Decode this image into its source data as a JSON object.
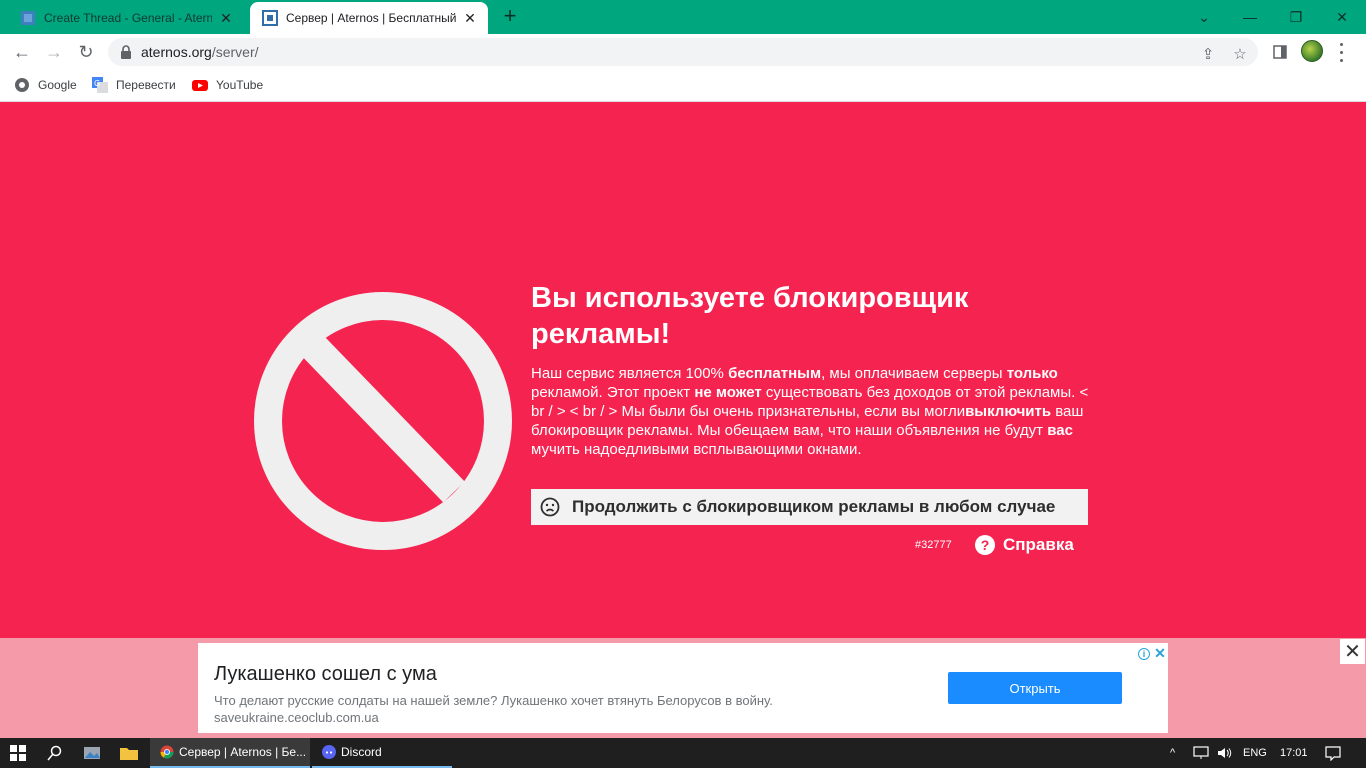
{
  "browser": {
    "tabs": [
      {
        "title": "Create Thread - General - Aternos",
        "active": false
      },
      {
        "title": "Сервер | Aternos | Бесплатный сервер",
        "active": true
      }
    ],
    "url_host": "aternos.org",
    "url_path": "/server/",
    "bookmarks": [
      {
        "label": "Google",
        "icon": "google-icon"
      },
      {
        "label": "Перевести",
        "icon": "translate-icon"
      },
      {
        "label": "YouTube",
        "icon": "youtube-icon"
      }
    ]
  },
  "main": {
    "headline": "Вы используете блокировщик рекламы!",
    "desc_parts": {
      "p1": "Наш сервис является 100% ",
      "b1": "бесплатным",
      "p2": ", мы оплачиваем серверы ",
      "b2": "только",
      "p3": " рекламой. Этот проект ",
      "b3": "не может",
      "p4": " существовать без доходов от этой рекламы. < br / > < br / > Мы были бы очень признательны, если вы могли",
      "b4": "выключить",
      "p5": " ваш блокировщик рекламы. Мы обещаем вам, что наши объявления не будут ",
      "b5": "вас",
      "p6": " мучить надоедливыми всплывающими окнами."
    },
    "continue_label": "Продолжить с блокировщиком рекламы в любом случае",
    "error_code": "#32777",
    "help_label": "Справка"
  },
  "ad": {
    "title": "Лукашенко сошел с ума",
    "text": "Что делают русские солдаты на нашей земле? Лукашенко хочет втянуть Белорусов в войну.",
    "url": "saveukraine.ceoclub.com.ua",
    "cta": "Открыть"
  },
  "taskbar": {
    "apps": [
      {
        "label": "Сервер | Aternos | Бе...",
        "icon": "chrome-icon"
      },
      {
        "label": "Discord",
        "icon": "discord-icon"
      }
    ],
    "language": "ENG",
    "time": "17:01"
  },
  "colors": {
    "page_bg": "#f5234f",
    "tabstrip": "#00a67e",
    "ad_bg": "#f59aa8",
    "ad_button": "#1a8cff"
  }
}
